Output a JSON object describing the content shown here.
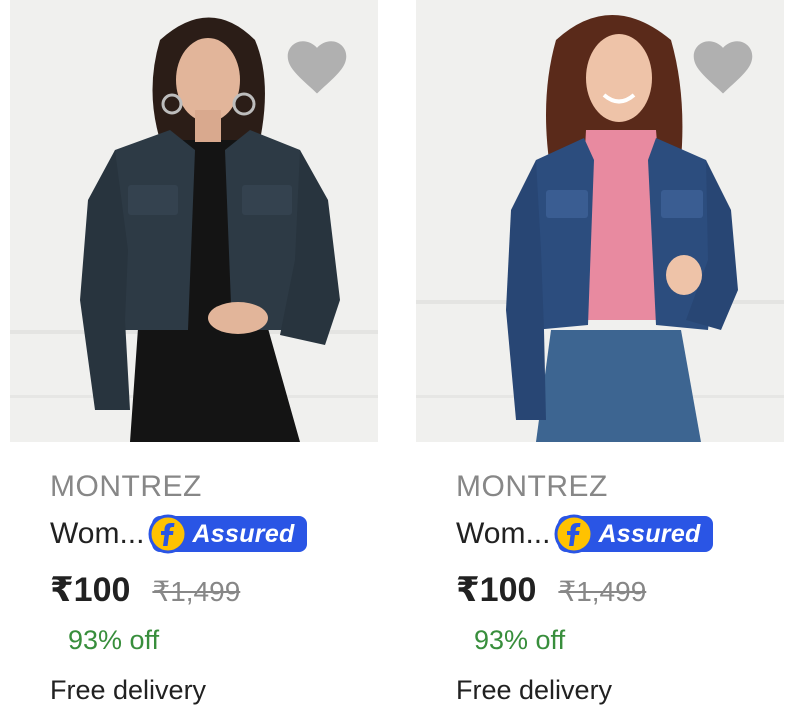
{
  "products": [
    {
      "brand": "MONTREZ",
      "title": "Wom...",
      "badge": "Assured",
      "price": "₹100",
      "mrp": "₹1,499",
      "discount": "93% off",
      "delivery": "Free delivery",
      "image_icon": "product-image",
      "wishlist_icon": "heart-icon"
    },
    {
      "brand": "MONTREZ",
      "title": "Wom...",
      "badge": "Assured",
      "price": "₹100",
      "mrp": "₹1,499",
      "discount": "93% off",
      "delivery": "Free delivery",
      "image_icon": "product-image",
      "wishlist_icon": "heart-icon"
    }
  ],
  "colors": {
    "brand_gray": "#878787",
    "text_dark": "#212121",
    "discount_green": "#388e3c",
    "assured_blue": "#2a55e5",
    "heart_gray": "#b0b0b0"
  }
}
